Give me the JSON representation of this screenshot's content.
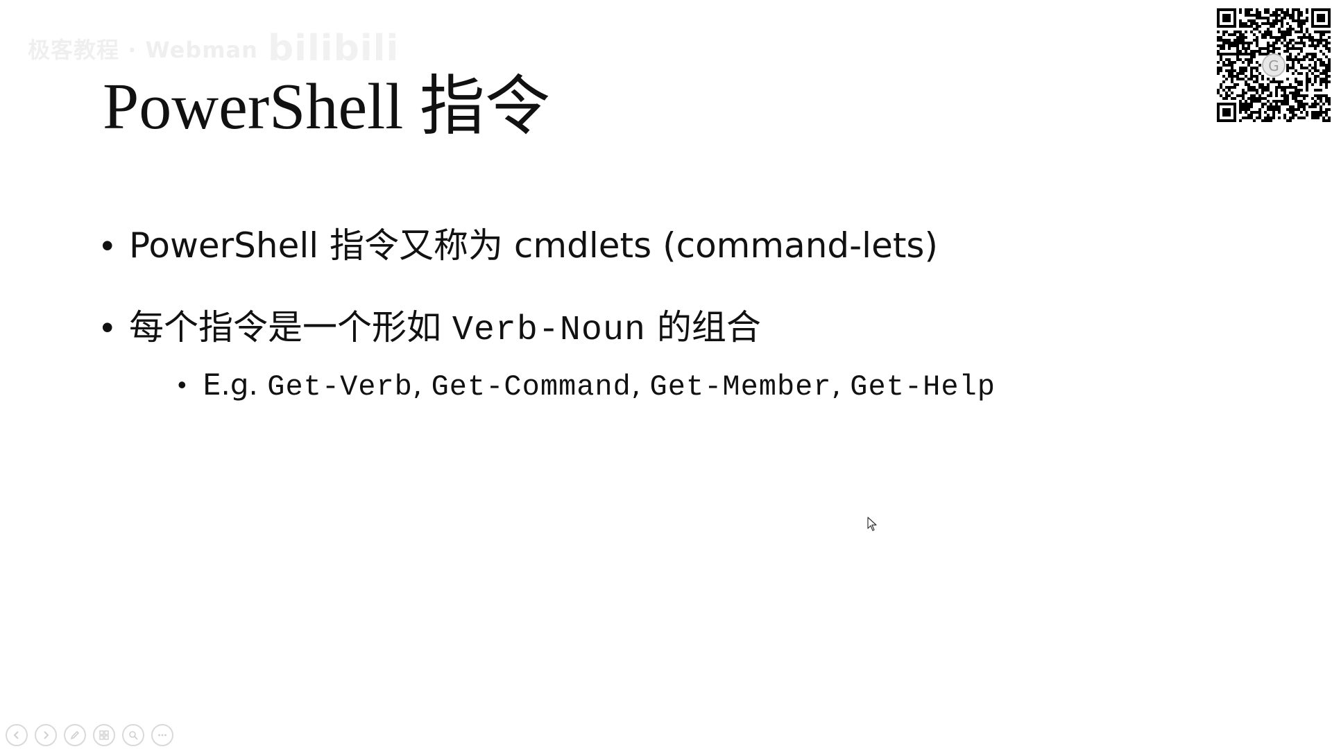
{
  "watermark": {
    "text": "极客教程 · Webman",
    "brand": "bilibili"
  },
  "slide": {
    "title": "PowerShell 指令",
    "bullets": [
      {
        "text": "PowerShell 指令又称为 cmdlets (command-lets)"
      },
      {
        "prefix": "每个指令是一个形如 ",
        "code": "Verb-Noun",
        "suffix": " 的组合"
      }
    ],
    "sub_bullet": {
      "prefix": "E.g. ",
      "examples": [
        "Get-Verb",
        "Get-Command",
        "Get-Member",
        "Get-Help"
      ],
      "separator": ", "
    }
  },
  "icons": {
    "qr": "qr-code-icon",
    "cursor": "mouse-pointer-icon",
    "controls": [
      "previous-slide-icon",
      "next-slide-icon",
      "pen-icon",
      "slides-grid-icon",
      "zoom-icon",
      "more-options-icon"
    ]
  },
  "colors": {
    "text": "#111111",
    "control_outline": "#d9d9d9",
    "watermark": "#cfcfcf"
  }
}
